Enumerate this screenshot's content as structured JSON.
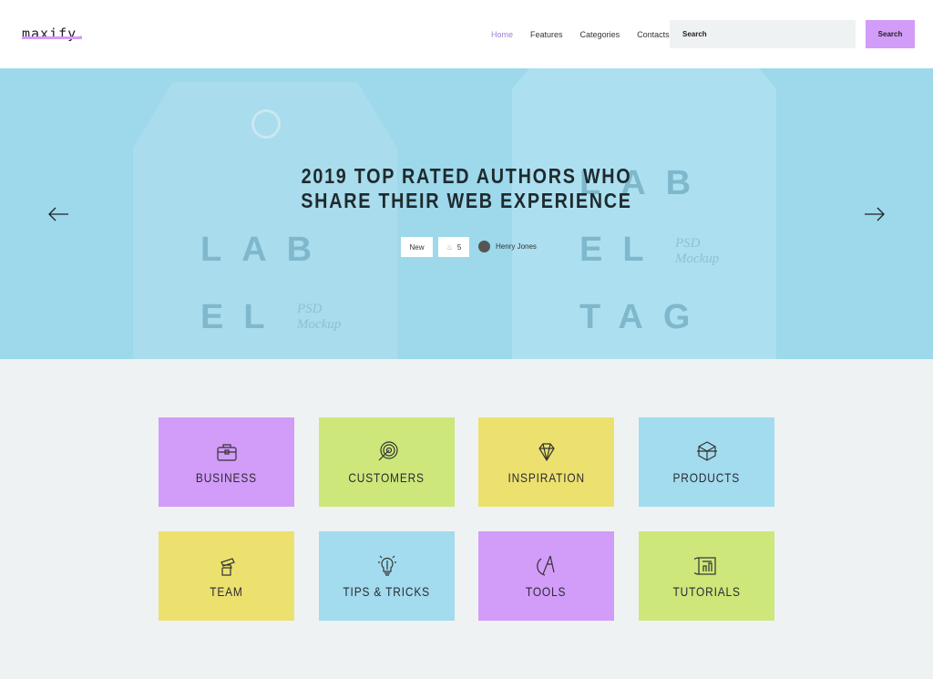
{
  "header": {
    "logo": "maxify.",
    "nav": [
      {
        "label": "Home",
        "active": true
      },
      {
        "label": "Features"
      },
      {
        "label": "Categories"
      },
      {
        "label": "Contacts"
      }
    ],
    "search_placeholder": "Search",
    "search_button": "Search"
  },
  "hero": {
    "title": "2019 TOP RATED AUTHORS WHO SHARE THEIR WEB EXPERIENCE",
    "badge_new": "New",
    "likes": "5",
    "author": "Henry Jones",
    "image_text": {
      "left1": "LAB",
      "left2": "EL",
      "left_sub": "PSD\nMockup",
      "right1": "LAB",
      "right2": "EL",
      "right3": "TAG",
      "right_sub": "PSD\nMockup"
    },
    "bg_color": "#9dd8eb"
  },
  "colors": {
    "purple": "#d29cf9",
    "green": "#cde77a",
    "yellow": "#ece16f",
    "blue": "#a2dcee",
    "page_bg": "#eff2f3"
  },
  "categories": [
    {
      "label": "BUSINESS",
      "icon": "briefcase-icon",
      "color": "#d29cf9"
    },
    {
      "label": "CUSTOMERS",
      "icon": "target-icon",
      "color": "#cde77a"
    },
    {
      "label": "INSPIRATION",
      "icon": "diamond-icon",
      "color": "#ece16f"
    },
    {
      "label": "PRODUCTS",
      "icon": "cube-icon",
      "color": "#a2dcee"
    },
    {
      "label": "TEAM",
      "icon": "hand-pencil-icon",
      "color": "#ece16f"
    },
    {
      "label": "TIPS & TRICKS",
      "icon": "lightbulb-icon",
      "color": "#a2dcee"
    },
    {
      "label": "TOOLS",
      "icon": "compass-icon",
      "color": "#d29cf9"
    },
    {
      "label": "TUTORIALS",
      "icon": "blueprint-icon",
      "color": "#cde77a"
    }
  ]
}
